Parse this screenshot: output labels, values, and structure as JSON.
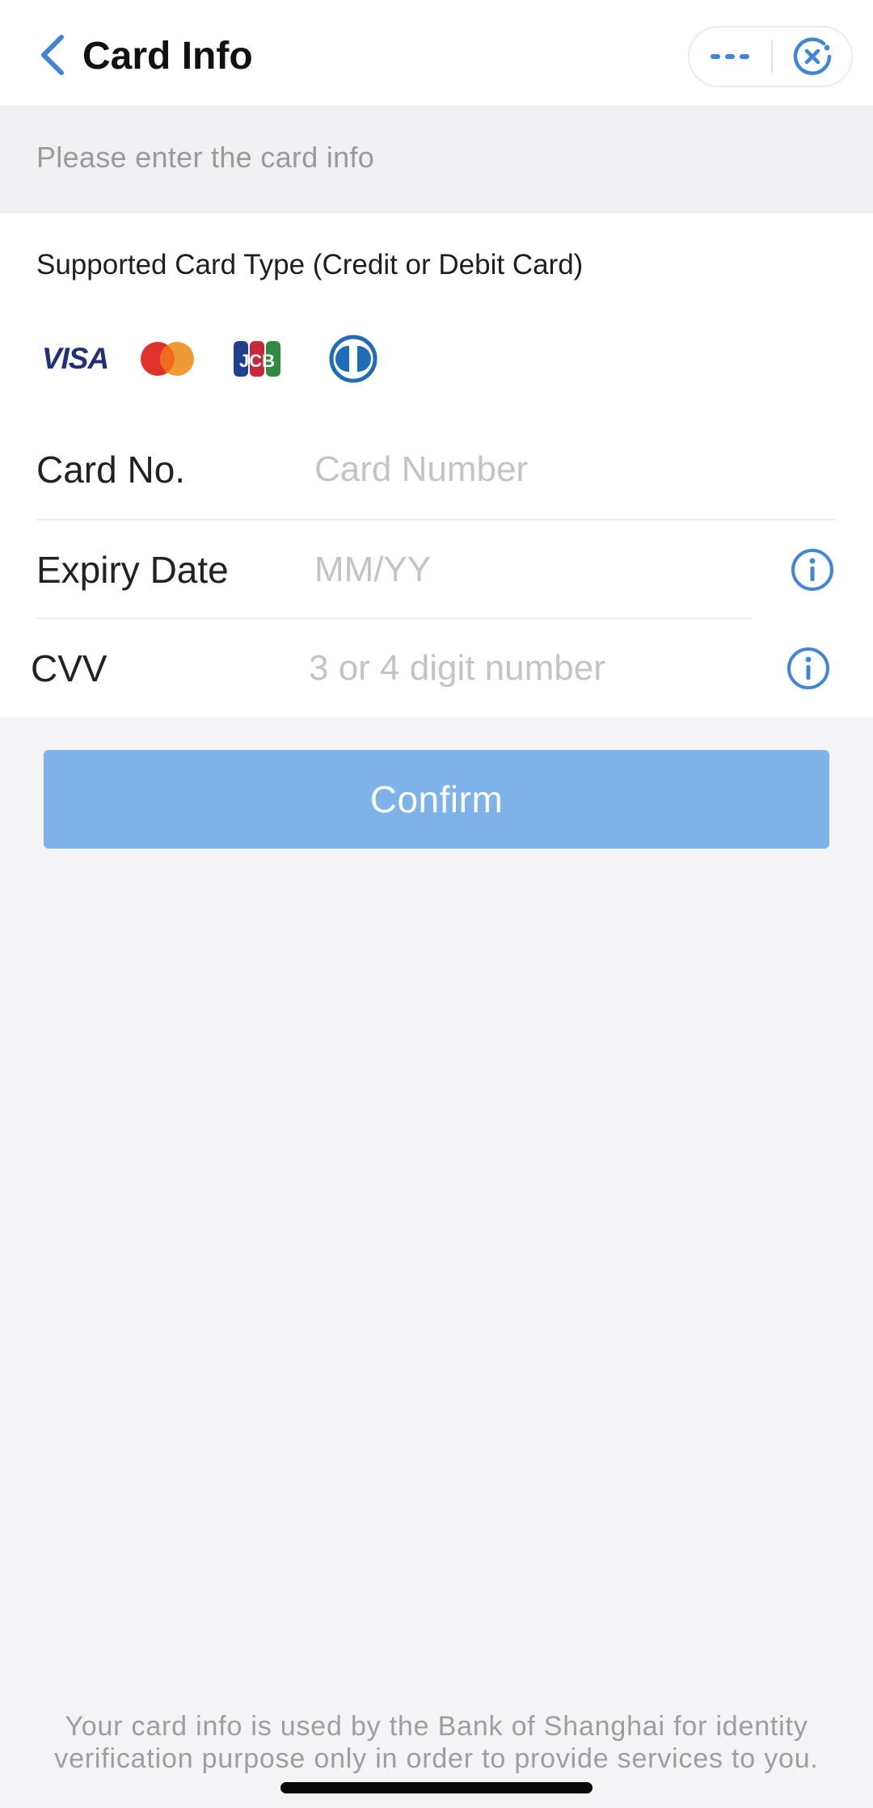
{
  "nav": {
    "title": "Card Info",
    "back_icon": "chevron-left-icon",
    "more_icon": "more-dots-icon",
    "close_icon": "close-circle-icon",
    "accent_color": "#3f86d8"
  },
  "hint": {
    "text": "Please enter the card info"
  },
  "card_types": {
    "title": "Supported Card Type (Credit or Debit Card)",
    "logos": [
      "visa-logo",
      "mastercard-logo",
      "jcb-logo",
      "diners-club-logo"
    ]
  },
  "form": {
    "card_number": {
      "label": "Card No.",
      "placeholder": "Card Number",
      "value": ""
    },
    "expiry": {
      "label": "Expiry Date",
      "placeholder": "MM/YY",
      "value": "",
      "info_icon": "info-circle-icon"
    },
    "cvv": {
      "label": "CVV",
      "placeholder": "3 or 4 digit number",
      "value": "",
      "info_icon": "info-circle-icon"
    }
  },
  "confirm": {
    "label": "Confirm",
    "color": "#7eb3ea"
  },
  "footer": {
    "line1": "Your card info is used by the Bank of Shanghai for identity",
    "line2": "verification purpose only in order to provide services to you."
  }
}
